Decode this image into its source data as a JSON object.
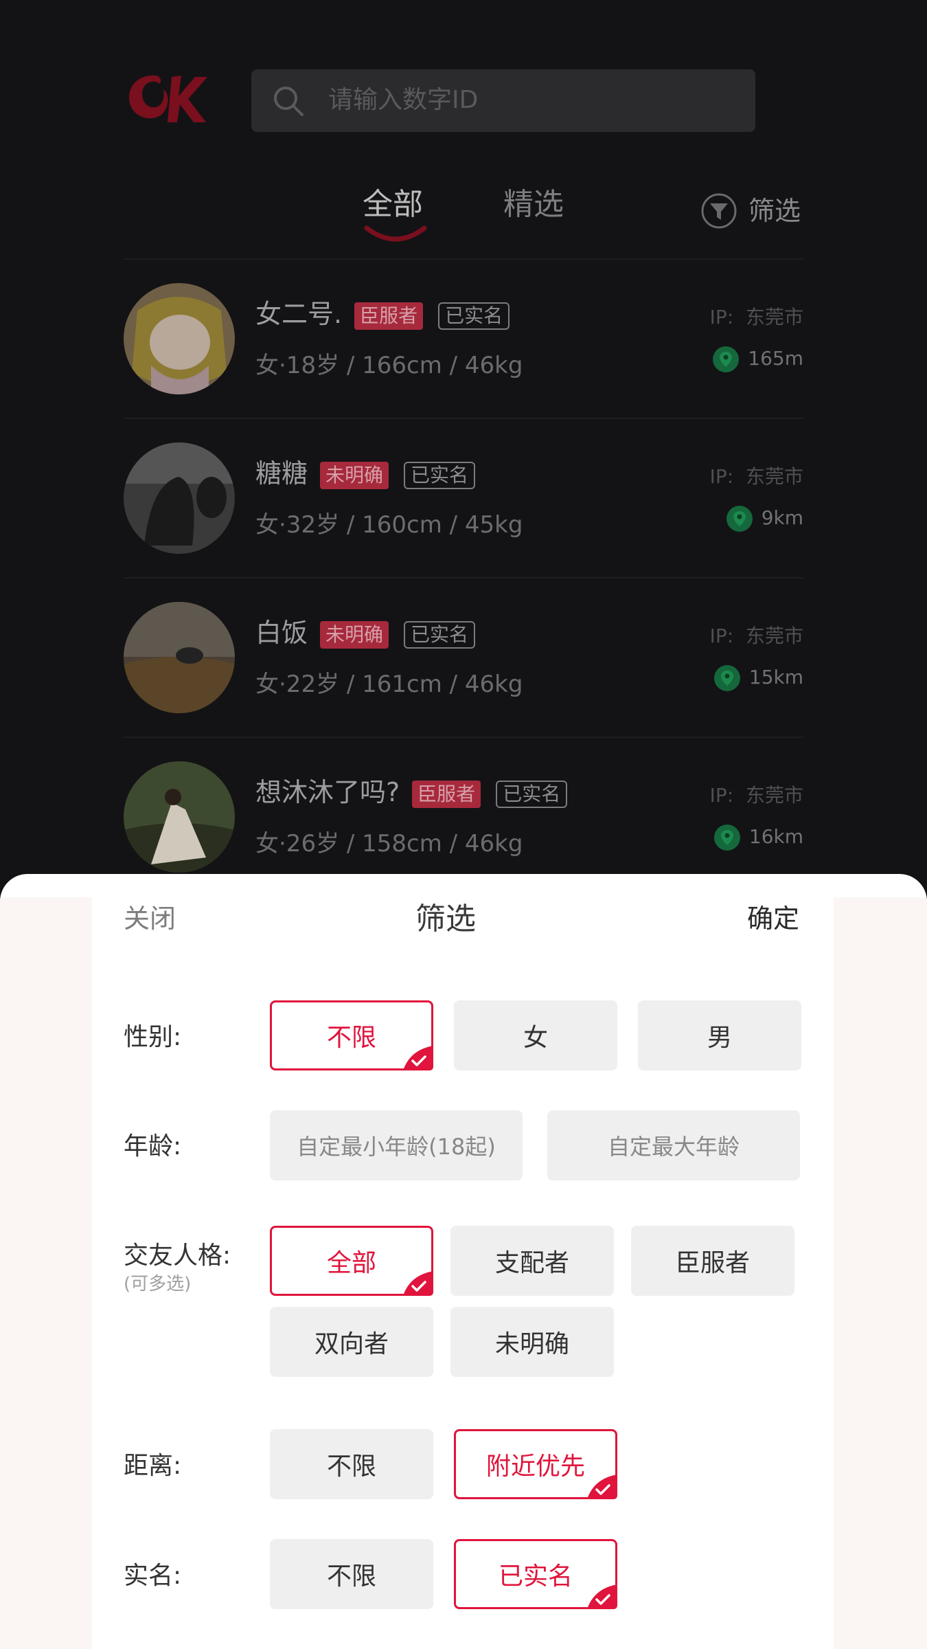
{
  "header": {
    "logo_text": "OK",
    "search_placeholder": "请输入数字ID"
  },
  "tabs": [
    {
      "label": "全部",
      "active": true
    },
    {
      "label": "精选",
      "active": false
    }
  ],
  "filter_label": "筛选",
  "users": [
    {
      "name": "女二号.",
      "role": "臣服者",
      "verified": "已实名",
      "meta": "女·18岁 / 166cm / 46kg",
      "ip_label": "IP:",
      "ip_city": "东莞市",
      "distance": "165m"
    },
    {
      "name": "糖糖",
      "role": "未明确",
      "verified": "已实名",
      "meta": "女·32岁 / 160cm / 45kg",
      "ip_label": "IP:",
      "ip_city": "东莞市",
      "distance": "9km"
    },
    {
      "name": "白饭",
      "role": "未明确",
      "verified": "已实名",
      "meta": "女·22岁 / 161cm / 46kg",
      "ip_label": "IP:",
      "ip_city": "东莞市",
      "distance": "15km"
    },
    {
      "name": "想沐沐了吗?",
      "role": "臣服者",
      "verified": "已实名",
      "meta": "女·26岁 / 158cm / 46kg",
      "ip_label": "IP:",
      "ip_city": "东莞市",
      "distance": "16km"
    }
  ],
  "sheet": {
    "close": "关闭",
    "title": "筛选",
    "confirm": "确定",
    "gender": {
      "label": "性别:",
      "options": [
        "不限",
        "女",
        "男"
      ],
      "selected": "不限"
    },
    "age": {
      "label": "年龄:",
      "min_placeholder": "自定最小年龄(18起)",
      "max_placeholder": "自定最大年龄"
    },
    "persona": {
      "label": "交友人格:",
      "hint": "(可多选)",
      "options": [
        "全部",
        "支配者",
        "臣服者",
        "双向者",
        "未明确"
      ],
      "selected": "全部"
    },
    "distance": {
      "label": "距离:",
      "options": [
        "不限",
        "附近优先"
      ],
      "selected": "附近优先"
    },
    "realname": {
      "label": "实名:",
      "options": [
        "不限",
        "已实名"
      ],
      "selected": "已实名"
    }
  },
  "colors": {
    "accent": "#e0143c",
    "pin": "#1aa35a",
    "overlay_bg": "#131315"
  }
}
